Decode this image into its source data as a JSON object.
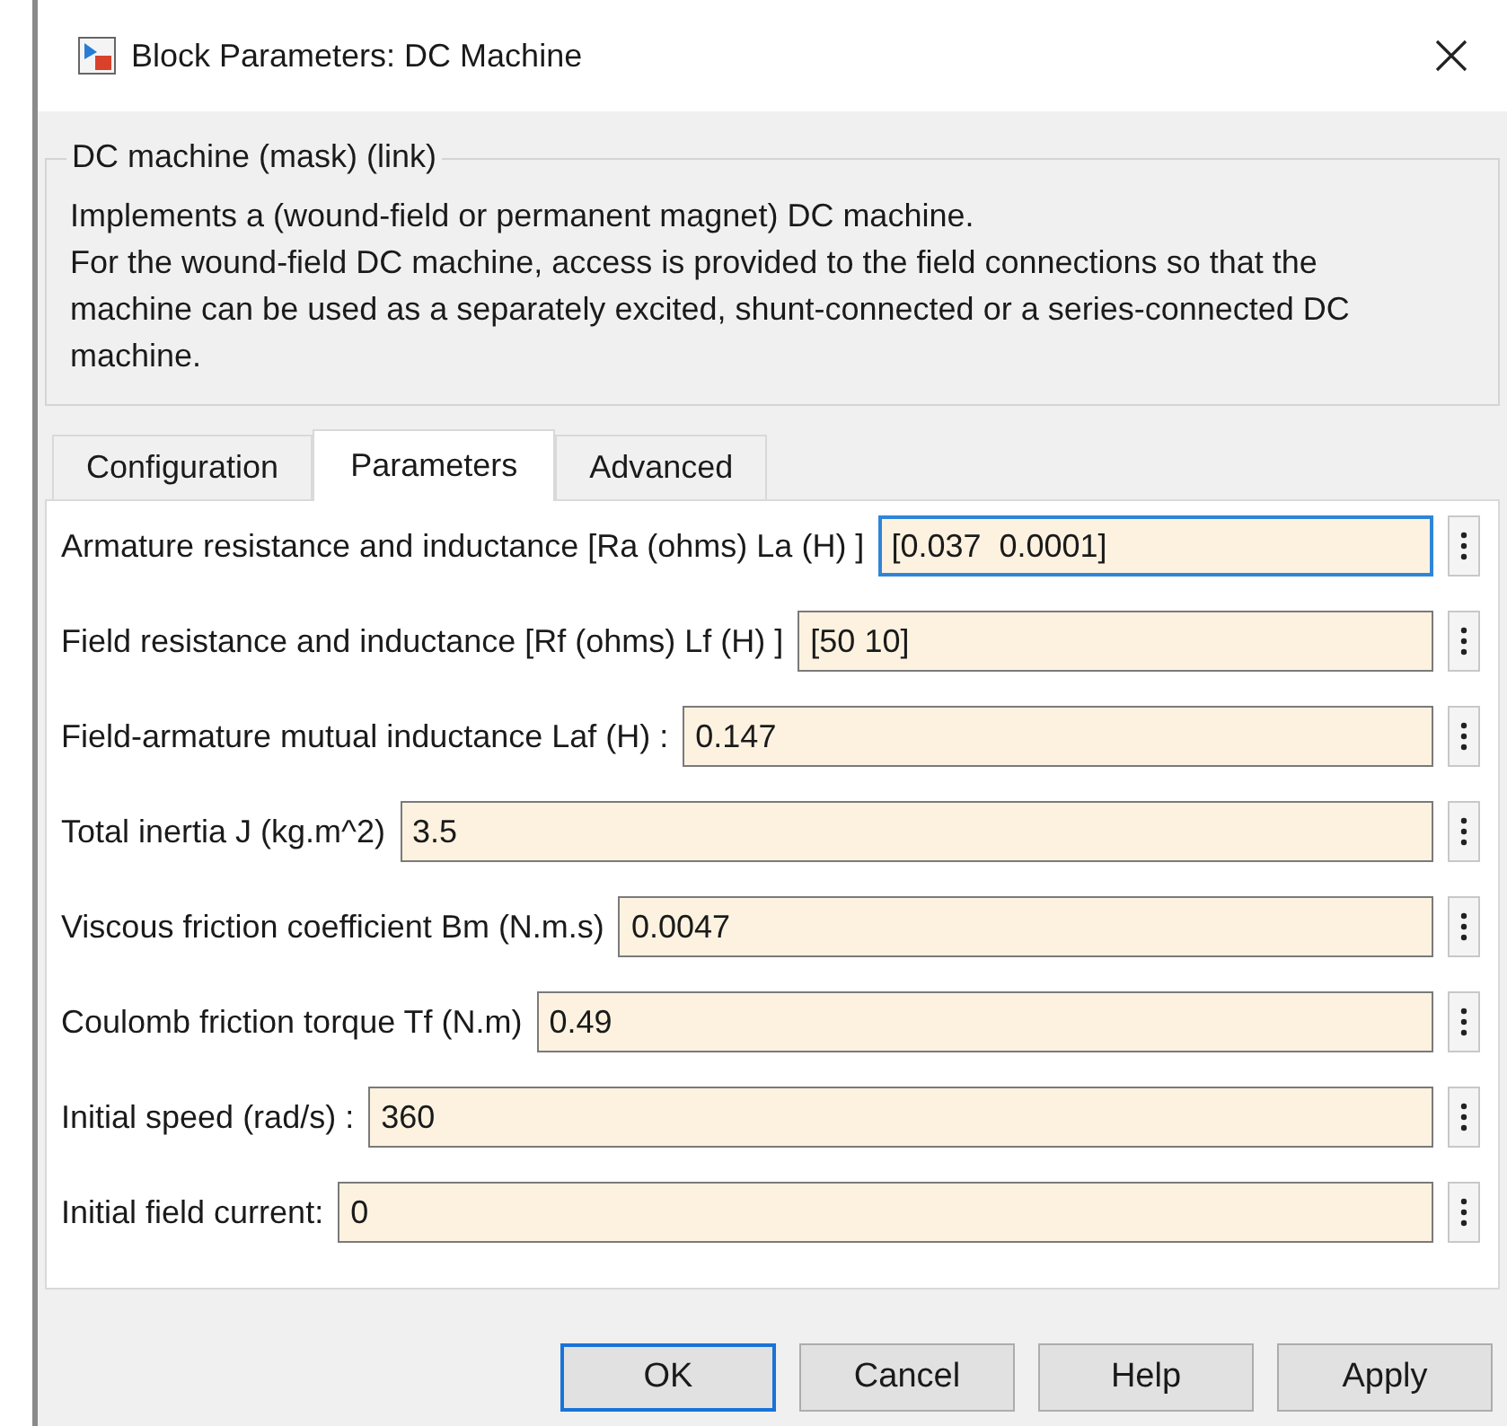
{
  "window": {
    "title": "Block Parameters: DC Machine"
  },
  "group": {
    "title": "DC machine (mask) (link)",
    "description": [
      "Implements a (wound-field or permanent magnet) DC machine.",
      "For the wound-field DC machine, access is provided to the field connections so that the machine can be used as a separately excited, shunt-connected or a series-connected  DC machine."
    ]
  },
  "tabs": [
    {
      "label": "Configuration",
      "selected": false
    },
    {
      "label": "Parameters",
      "selected": true
    },
    {
      "label": "Advanced",
      "selected": false
    }
  ],
  "parameters": [
    {
      "label": "Armature resistance and inductance [Ra (ohms) La (H) ]",
      "value": "[0.037  0.0001]",
      "focused": true
    },
    {
      "label": "Field resistance and inductance [Rf (ohms) Lf (H) ]",
      "value": "[50 10]",
      "focused": false
    },
    {
      "label": "Field-armature mutual inductance Laf (H) :",
      "value": "0.147",
      "focused": false
    },
    {
      "label": "Total inertia J (kg.m^2)",
      "value": "3.5",
      "focused": false
    },
    {
      "label": "Viscous friction coefficient Bm (N.m.s)",
      "value": "0.0047",
      "focused": false
    },
    {
      "label": "Coulomb friction torque Tf (N.m)",
      "value": "0.49",
      "focused": false
    },
    {
      "label": "Initial speed (rad/s) :",
      "value": "360",
      "focused": false
    },
    {
      "label": "Initial field current:",
      "value": "0",
      "focused": false
    }
  ],
  "buttons": [
    {
      "label": "OK",
      "default": true
    },
    {
      "label": "Cancel",
      "default": false
    },
    {
      "label": "Help",
      "default": false
    },
    {
      "label": "Apply",
      "default": false
    }
  ]
}
